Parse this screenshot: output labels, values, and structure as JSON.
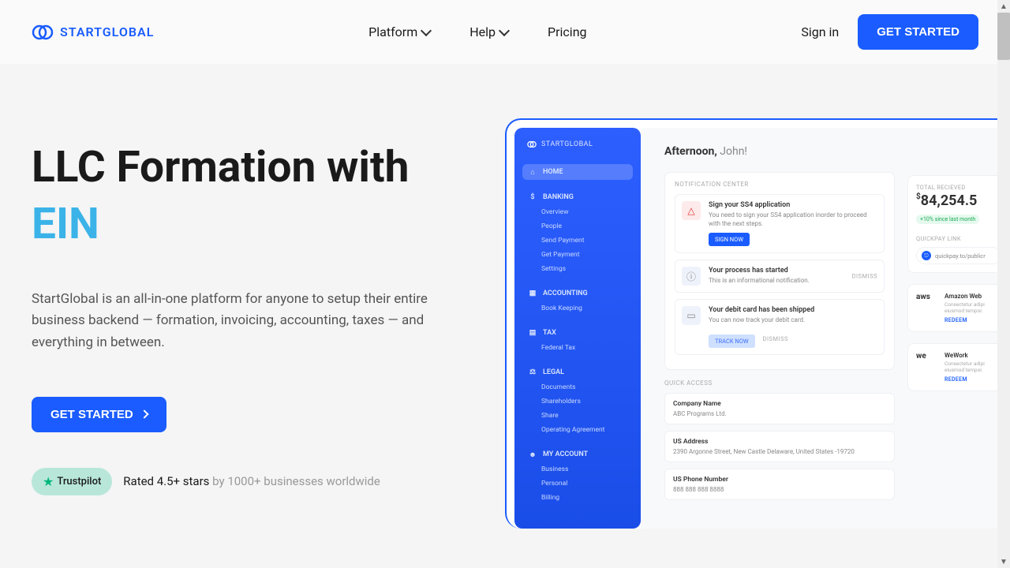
{
  "brand": "STARTGLOBAL",
  "nav": {
    "platform": "Platform",
    "help": "Help",
    "pricing": "Pricing"
  },
  "header": {
    "signin": "Sign in",
    "cta": "GET STARTED"
  },
  "hero": {
    "title": "LLC Formation with",
    "accent": "EIN",
    "desc": "StartGlobal is an all-in-one platform for anyone to setup their entire business backend — formation, invoicing, accounting, taxes — and everything in between.",
    "cta": "GET STARTED"
  },
  "trust": {
    "badge": "Trustpilot",
    "rated": "Rated 4.5+ stars ",
    "by": "by 1000+ businesses worldwide"
  },
  "mock": {
    "brand": "STARTGLOBAL",
    "sidebar": {
      "home": "HOME",
      "banking": "BANKING",
      "banking_items": [
        "Overview",
        "People",
        "Send Payment",
        "Get Payment",
        "Settings"
      ],
      "accounting": "ACCOUNTING",
      "accounting_items": [
        "Book Keeping"
      ],
      "tax": "TAX",
      "tax_items": [
        "Federal Tax"
      ],
      "legal": "LEGAL",
      "legal_items": [
        "Documents",
        "Shareholders",
        "Share",
        "Operating Agreement"
      ],
      "account": "MY ACCOUNT",
      "account_items": [
        "Business",
        "Personal",
        "Billing"
      ]
    },
    "greeting_bold": "Afternoon,",
    "greeting_name": " John!",
    "notif_center": "NOTIFICATION CENTER",
    "notifs": {
      "n1_title": "Sign your SS4 application",
      "n1_text": "You need to sign your SS4 application inorder to proceed with the next steps.",
      "n1_btn": "SIGN NOW",
      "n2_title": "Your process has started",
      "n2_text": "This is an informational notification.",
      "n2_dismiss": "DISMISS",
      "n3_title": "Your debit card has been shipped",
      "n3_text": "You can now track your debit card.",
      "n3_btn": "TRACK NOW",
      "n3_dismiss": "DISMISS"
    },
    "quick_access": "QUICK ACCESS",
    "qa": {
      "company_label": "Company Name",
      "company_val": "ABC Programs Ltd.",
      "addr_label": "US Address",
      "addr_val": "2390  Argonne Street, New Castle Delaware, United States -19720",
      "phone_label": "US Phone Number",
      "phone_val": "888 888 888 8888"
    },
    "right": {
      "total_label": "TOTAL RECIEVED",
      "total_val": "84,254.5",
      "chip": "+10% since last month",
      "quickpay_label": "QUICKPAY LINK",
      "quickpay_val": "quickpay.to/publicr",
      "aws_logo": "aws",
      "aws_name": "Amazon Web",
      "aws_desc": "Consectetur adipi eiusmod tempor.",
      "we_logo": "we",
      "we_name": "WeWork",
      "we_desc": "Consectetur adipi eiusmod tempor.",
      "redeem": "REDEEM"
    }
  }
}
